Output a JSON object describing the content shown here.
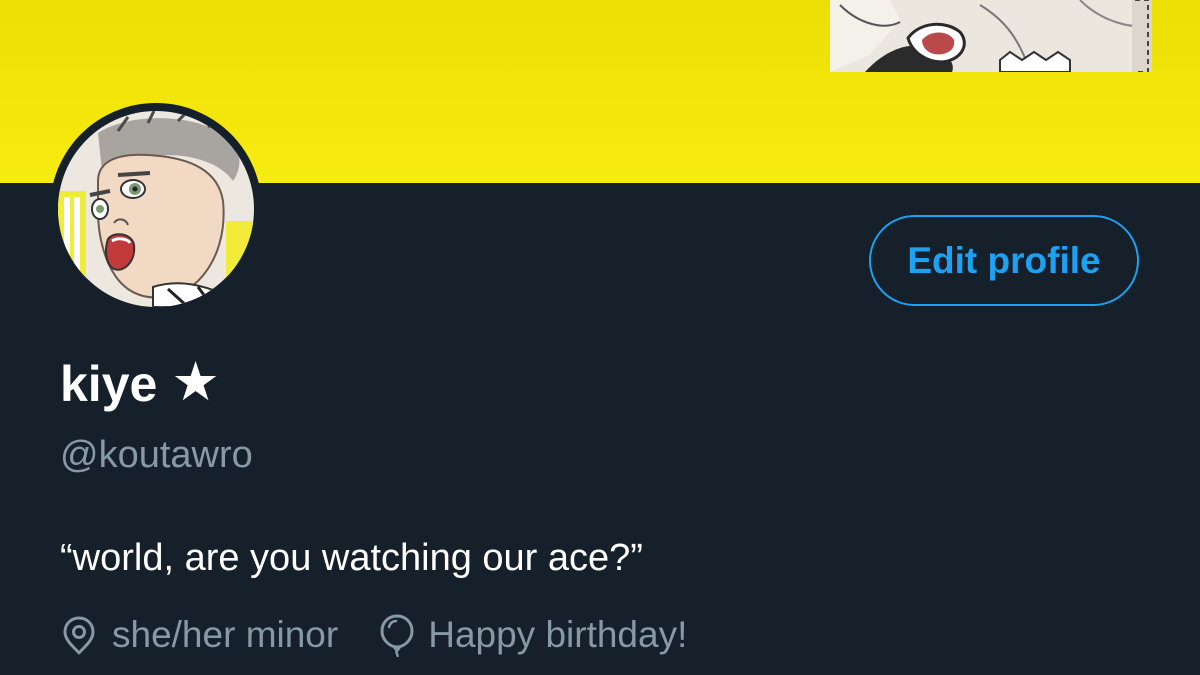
{
  "banner": {
    "background_color": "#f3e60a"
  },
  "profile": {
    "display_name": "kiye",
    "name_badge": "★",
    "handle": "@koutawro",
    "bio": "“world, are you watching our ace?”",
    "location": "she/her minor",
    "location_icon": "location-pin-icon",
    "birthday": "Happy birthday!",
    "birthday_icon": "balloon-icon"
  },
  "actions": {
    "edit_profile_label": "Edit profile"
  },
  "colors": {
    "background": "#15202b",
    "accent": "#1da1f2",
    "secondary_text": "#8899a6",
    "primary_text": "#ffffff"
  }
}
